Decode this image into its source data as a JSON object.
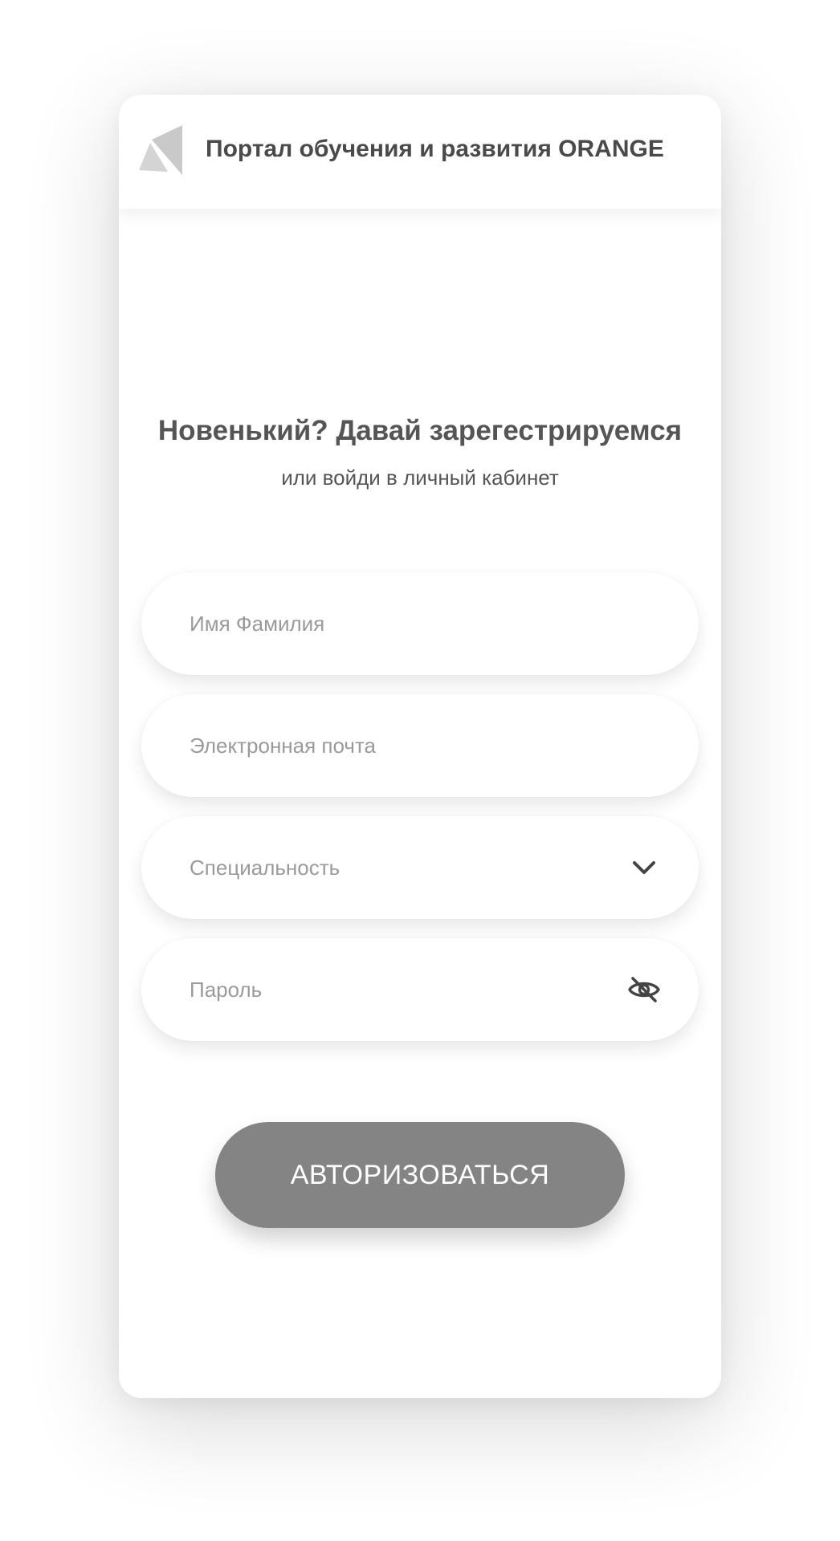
{
  "header": {
    "logo_icon": "triangle-logo-icon",
    "title": "Портал обучения и развития ORANGE"
  },
  "form": {
    "heading": "Новенький? Давай зарегестрируемся",
    "subheading": "или войди в личный кабинет",
    "fields": {
      "name": {
        "placeholder": "Имя Фамилия",
        "value": ""
      },
      "email": {
        "placeholder": "Электронная почта",
        "value": ""
      },
      "specialty": {
        "label": "Специальность",
        "icon": "chevron-down-icon"
      },
      "password": {
        "placeholder": "Пароль",
        "value": "",
        "icon": "eye-off-icon"
      }
    },
    "submit_label": "АВТОРИЗОВАТЬСЯ"
  },
  "colors": {
    "button": "#848484",
    "heading_text": "#555555",
    "placeholder_text": "#9a9a9a",
    "logo_gray": "#c8c8c8"
  }
}
